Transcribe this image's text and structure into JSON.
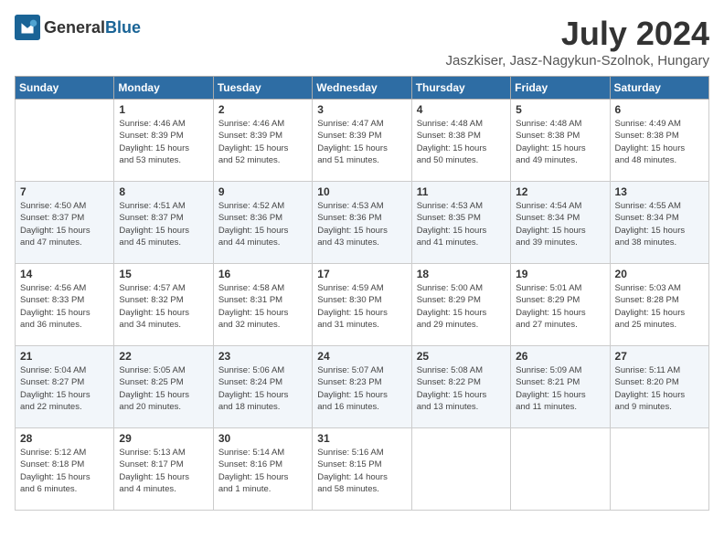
{
  "logo": {
    "general": "General",
    "blue": "Blue"
  },
  "title": "July 2024",
  "location": "Jaszkiser, Jasz-Nagykun-Szolnok, Hungary",
  "headers": [
    "Sunday",
    "Monday",
    "Tuesday",
    "Wednesday",
    "Thursday",
    "Friday",
    "Saturday"
  ],
  "weeks": [
    [
      {
        "day": "",
        "info": ""
      },
      {
        "day": "1",
        "info": "Sunrise: 4:46 AM\nSunset: 8:39 PM\nDaylight: 15 hours\nand 53 minutes."
      },
      {
        "day": "2",
        "info": "Sunrise: 4:46 AM\nSunset: 8:39 PM\nDaylight: 15 hours\nand 52 minutes."
      },
      {
        "day": "3",
        "info": "Sunrise: 4:47 AM\nSunset: 8:39 PM\nDaylight: 15 hours\nand 51 minutes."
      },
      {
        "day": "4",
        "info": "Sunrise: 4:48 AM\nSunset: 8:38 PM\nDaylight: 15 hours\nand 50 minutes."
      },
      {
        "day": "5",
        "info": "Sunrise: 4:48 AM\nSunset: 8:38 PM\nDaylight: 15 hours\nand 49 minutes."
      },
      {
        "day": "6",
        "info": "Sunrise: 4:49 AM\nSunset: 8:38 PM\nDaylight: 15 hours\nand 48 minutes."
      }
    ],
    [
      {
        "day": "7",
        "info": "Sunrise: 4:50 AM\nSunset: 8:37 PM\nDaylight: 15 hours\nand 47 minutes."
      },
      {
        "day": "8",
        "info": "Sunrise: 4:51 AM\nSunset: 8:37 PM\nDaylight: 15 hours\nand 45 minutes."
      },
      {
        "day": "9",
        "info": "Sunrise: 4:52 AM\nSunset: 8:36 PM\nDaylight: 15 hours\nand 44 minutes."
      },
      {
        "day": "10",
        "info": "Sunrise: 4:53 AM\nSunset: 8:36 PM\nDaylight: 15 hours\nand 43 minutes."
      },
      {
        "day": "11",
        "info": "Sunrise: 4:53 AM\nSunset: 8:35 PM\nDaylight: 15 hours\nand 41 minutes."
      },
      {
        "day": "12",
        "info": "Sunrise: 4:54 AM\nSunset: 8:34 PM\nDaylight: 15 hours\nand 39 minutes."
      },
      {
        "day": "13",
        "info": "Sunrise: 4:55 AM\nSunset: 8:34 PM\nDaylight: 15 hours\nand 38 minutes."
      }
    ],
    [
      {
        "day": "14",
        "info": "Sunrise: 4:56 AM\nSunset: 8:33 PM\nDaylight: 15 hours\nand 36 minutes."
      },
      {
        "day": "15",
        "info": "Sunrise: 4:57 AM\nSunset: 8:32 PM\nDaylight: 15 hours\nand 34 minutes."
      },
      {
        "day": "16",
        "info": "Sunrise: 4:58 AM\nSunset: 8:31 PM\nDaylight: 15 hours\nand 32 minutes."
      },
      {
        "day": "17",
        "info": "Sunrise: 4:59 AM\nSunset: 8:30 PM\nDaylight: 15 hours\nand 31 minutes."
      },
      {
        "day": "18",
        "info": "Sunrise: 5:00 AM\nSunset: 8:29 PM\nDaylight: 15 hours\nand 29 minutes."
      },
      {
        "day": "19",
        "info": "Sunrise: 5:01 AM\nSunset: 8:29 PM\nDaylight: 15 hours\nand 27 minutes."
      },
      {
        "day": "20",
        "info": "Sunrise: 5:03 AM\nSunset: 8:28 PM\nDaylight: 15 hours\nand 25 minutes."
      }
    ],
    [
      {
        "day": "21",
        "info": "Sunrise: 5:04 AM\nSunset: 8:27 PM\nDaylight: 15 hours\nand 22 minutes."
      },
      {
        "day": "22",
        "info": "Sunrise: 5:05 AM\nSunset: 8:25 PM\nDaylight: 15 hours\nand 20 minutes."
      },
      {
        "day": "23",
        "info": "Sunrise: 5:06 AM\nSunset: 8:24 PM\nDaylight: 15 hours\nand 18 minutes."
      },
      {
        "day": "24",
        "info": "Sunrise: 5:07 AM\nSunset: 8:23 PM\nDaylight: 15 hours\nand 16 minutes."
      },
      {
        "day": "25",
        "info": "Sunrise: 5:08 AM\nSunset: 8:22 PM\nDaylight: 15 hours\nand 13 minutes."
      },
      {
        "day": "26",
        "info": "Sunrise: 5:09 AM\nSunset: 8:21 PM\nDaylight: 15 hours\nand 11 minutes."
      },
      {
        "day": "27",
        "info": "Sunrise: 5:11 AM\nSunset: 8:20 PM\nDaylight: 15 hours\nand 9 minutes."
      }
    ],
    [
      {
        "day": "28",
        "info": "Sunrise: 5:12 AM\nSunset: 8:18 PM\nDaylight: 15 hours\nand 6 minutes."
      },
      {
        "day": "29",
        "info": "Sunrise: 5:13 AM\nSunset: 8:17 PM\nDaylight: 15 hours\nand 4 minutes."
      },
      {
        "day": "30",
        "info": "Sunrise: 5:14 AM\nSunset: 8:16 PM\nDaylight: 15 hours\nand 1 minute."
      },
      {
        "day": "31",
        "info": "Sunrise: 5:16 AM\nSunset: 8:15 PM\nDaylight: 14 hours\nand 58 minutes."
      },
      {
        "day": "",
        "info": ""
      },
      {
        "day": "",
        "info": ""
      },
      {
        "day": "",
        "info": ""
      }
    ]
  ]
}
